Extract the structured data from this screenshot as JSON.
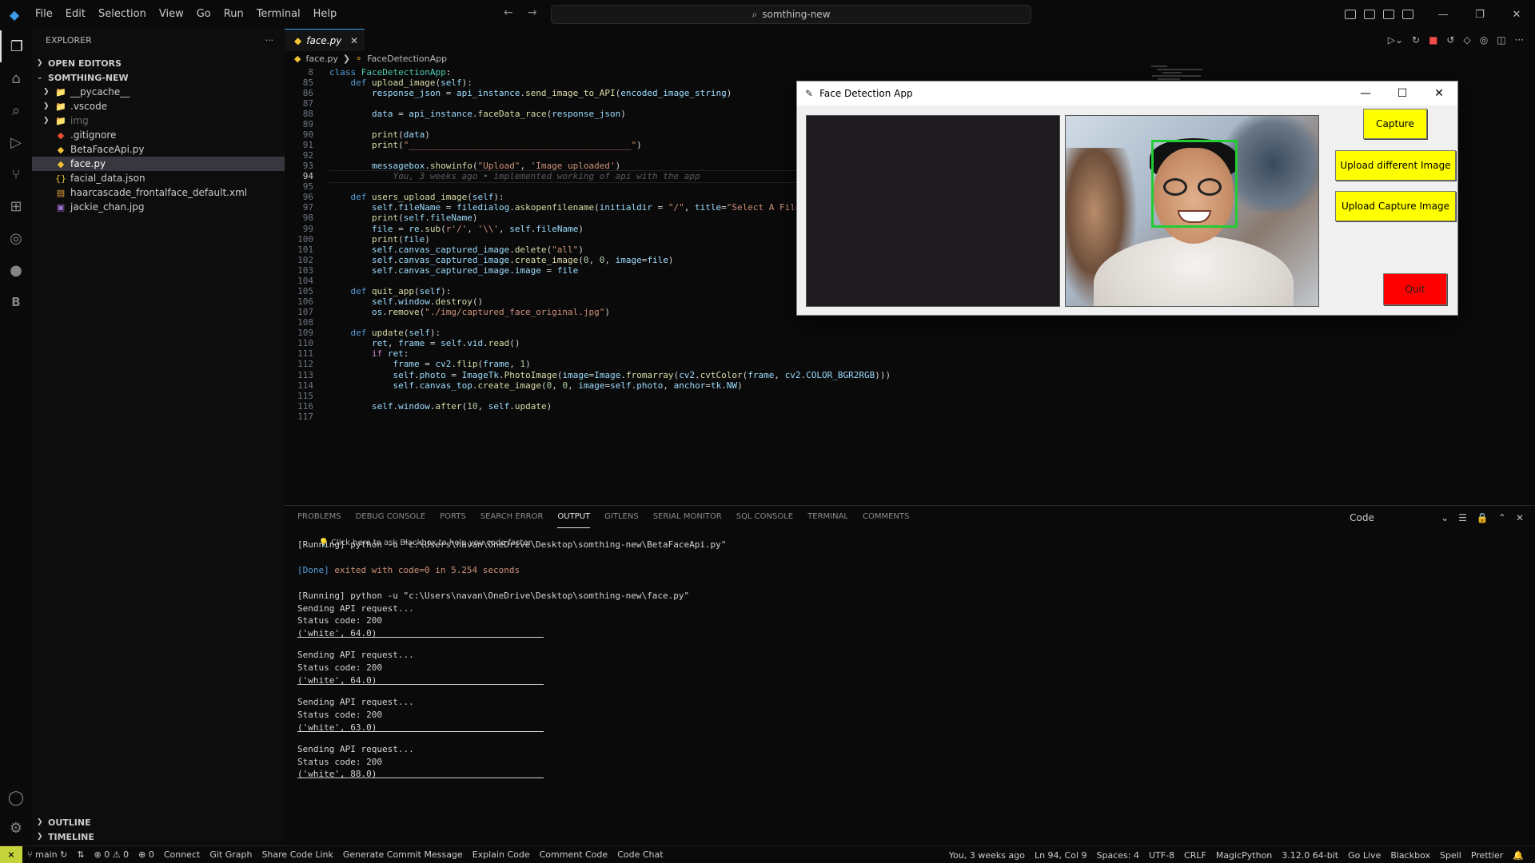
{
  "titlebar": {
    "menu": [
      "File",
      "Edit",
      "Selection",
      "View",
      "Go",
      "Run",
      "Terminal",
      "Help"
    ],
    "search_text": "somthing-new"
  },
  "sidebar": {
    "header": "EXPLORER",
    "open_editors": "OPEN EDITORS",
    "project": "SOMTHING-NEW",
    "items": [
      {
        "label": "__pycache__",
        "type": "folder",
        "color": "#cccccc"
      },
      {
        "label": ".vscode",
        "type": "folder",
        "color": "#cccccc"
      },
      {
        "label": "img",
        "type": "folder",
        "color": "#6e6e6e"
      },
      {
        "label": ".gitignore",
        "type": "git",
        "color": "#cccccc"
      },
      {
        "label": "BetaFaceApi.py",
        "type": "python",
        "color": "#cccccc"
      },
      {
        "label": "face.py",
        "type": "python",
        "color": "#ffffff"
      },
      {
        "label": "facial_data.json",
        "type": "json",
        "color": "#cccccc"
      },
      {
        "label": "haarcascade_frontalface_default.xml",
        "type": "xml",
        "color": "#cccccc"
      },
      {
        "label": "jackie_chan.jpg",
        "type": "image",
        "color": "#cccccc"
      }
    ],
    "outline": "OUTLINE",
    "timeline": "TIMELINE"
  },
  "editor": {
    "tab": "face.py",
    "breadcrumb_file": "face.py",
    "breadcrumb_class": "FaceDetectionApp",
    "lines": [
      {
        "n": "8",
        "html": "<span class='kw'>class</span> <span class='cls'>FaceDetectionApp</span>:"
      },
      {
        "n": "85",
        "html": "    <span class='kw'>def</span> <span class='fn'>upload_image</span>(<span class='var'>self</span>):"
      },
      {
        "n": "86",
        "html": "        <span class='var'>response_json</span> = <span class='var'>api_instance</span>.<span class='fn'>send_image_to_API</span>(<span class='var'>encoded_image_string</span>)"
      },
      {
        "n": "87",
        "html": ""
      },
      {
        "n": "88",
        "html": "        <span class='var'>data</span> = <span class='var'>api_instance</span>.<span class='fn'>faceData_race</span>(<span class='var'>response_json</span>)"
      },
      {
        "n": "89",
        "html": ""
      },
      {
        "n": "90",
        "html": "        <span class='fn'>print</span>(<span class='var'>data</span>)"
      },
      {
        "n": "91",
        "html": "        <span class='fn'>print</span>(<span class='str'>\"__________________________________________\"</span>)"
      },
      {
        "n": "92",
        "html": ""
      },
      {
        "n": "93",
        "html": "        <span class='var'>messagebox</span>.<span class='fn'>showinfo</span>(<span class='str'>\"Upload\"</span>, <span class='str'>'Image uploaded'</span>)"
      },
      {
        "n": "94",
        "html": "            <span class='blame'>You, 3 weeks ago • implemented working of api with the app</span>"
      },
      {
        "n": "95",
        "html": ""
      },
      {
        "n": "96",
        "html": "    <span class='kw'>def</span> <span class='fn'>users_upload_image</span>(<span class='var'>self</span>):"
      },
      {
        "n": "97",
        "html": "        <span class='var'>self</span>.<span class='var'>fileName</span> = <span class='var'>filedialog</span>.<span class='fn'>askopenfilename</span>(<span class='var'>initialdir</span> = <span class='str'>\"/\"</span>, <span class='var'>title</span>=<span class='str'>\"Select A File\"</span>,"
      },
      {
        "n": "98",
        "html": "        <span class='fn'>print</span>(<span class='var'>self</span>.<span class='var'>fileName</span>)"
      },
      {
        "n": "99",
        "html": "        <span class='var'>file</span> = <span class='var'>re</span>.<span class='fn'>sub</span>(<span class='str'>r'/'</span>, <span class='str'>'\\\\'</span>, <span class='var'>self</span>.<span class='var'>fileName</span>)"
      },
      {
        "n": "100",
        "html": "        <span class='fn'>print</span>(<span class='var'>file</span>)"
      },
      {
        "n": "101",
        "html": "        <span class='var'>self</span>.<span class='var'>canvas_captured_image</span>.<span class='fn'>delete</span>(<span class='str'>\"all\"</span>)"
      },
      {
        "n": "102",
        "html": "        <span class='var'>self</span>.<span class='var'>canvas_captured_image</span>.<span class='fn'>create_image</span>(<span class='num'>0</span>, <span class='num'>0</span>, <span class='var'>image</span>=<span class='var'>file</span>)"
      },
      {
        "n": "103",
        "html": "        <span class='var'>self</span>.<span class='var'>canvas_captured_image</span>.<span class='var'>image</span> = <span class='var'>file</span>"
      },
      {
        "n": "104",
        "html": ""
      },
      {
        "n": "105",
        "html": "    <span class='kw'>def</span> <span class='fn'>quit_app</span>(<span class='var'>self</span>):"
      },
      {
        "n": "106",
        "html": "        <span class='var'>self</span>.<span class='var'>window</span>.<span class='fn'>destroy</span>()"
      },
      {
        "n": "107",
        "html": "        <span class='var'>os</span>.<span class='fn'>remove</span>(<span class='str'>\"./img/captured_face_original.jpg\"</span>)"
      },
      {
        "n": "108",
        "html": ""
      },
      {
        "n": "109",
        "html": "    <span class='kw'>def</span> <span class='fn'>update</span>(<span class='var'>self</span>):"
      },
      {
        "n": "110",
        "html": "        <span class='var'>ret</span>, <span class='var'>frame</span> = <span class='var'>self</span>.<span class='var'>vid</span>.<span class='fn'>read</span>()"
      },
      {
        "n": "111",
        "html": "        <span class='kw2'>if</span> <span class='var'>ret</span>:"
      },
      {
        "n": "112",
        "html": "            <span class='var'>frame</span> = <span class='var'>cv2</span>.<span class='fn'>flip</span>(<span class='var'>frame</span>, <span class='num'>1</span>)"
      },
      {
        "n": "113",
        "html": "            <span class='var'>self</span>.<span class='var'>photo</span> = <span class='var'>ImageTk</span>.<span class='fn'>PhotoImage</span>(<span class='var'>image</span>=<span class='var'>Image</span>.<span class='fn'>fromarray</span>(<span class='var'>cv2</span>.<span class='fn'>cvtColor</span>(<span class='var'>frame</span>, <span class='var'>cv2</span>.<span class='var'>COLOR_BGR2RGB</span>)))"
      },
      {
        "n": "114",
        "html": "            <span class='var'>self</span>.<span class='var'>canvas_top</span>.<span class='fn'>create_image</span>(<span class='num'>0</span>, <span class='num'>0</span>, <span class='var'>image</span>=<span class='var'>self</span>.<span class='var'>photo</span>, <span class='var'>anchor</span>=<span class='var'>tk</span>.<span class='var'>NW</span>)"
      },
      {
        "n": "115",
        "html": ""
      },
      {
        "n": "116",
        "html": "        <span class='var'>self</span>.<span class='var'>window</span>.<span class='fn'>after</span>(<span class='num'>10</span>, <span class='var'>self</span>.<span class='fn'>update</span>)"
      },
      {
        "n": "117",
        "html": ""
      }
    ]
  },
  "panel": {
    "tabs": [
      "PROBLEMS",
      "DEBUG CONSOLE",
      "PORTS",
      "SEARCH ERROR",
      "OUTPUT",
      "GITLENS",
      "SERIAL MONITOR",
      "SQL CONSOLE",
      "TERMINAL",
      "COMMENTS"
    ],
    "active_tab": "OUTPUT",
    "channel": "Code",
    "hint": "💡 Click here to ask Blackbox to help you code faster",
    "output": [
      "[Running] python -u \"c:\\Users\\navan\\OneDrive\\Desktop\\somthing-new\\BetaFaceApi.py\"",
      "",
      "[Done] exited with code=0 in 5.254 seconds",
      "",
      "[Running] python -u \"c:\\Users\\navan\\OneDrive\\Desktop\\somthing-new\\face.py\"",
      "Sending API request...",
      "Status code: 200",
      "('white', 64.0)",
      "__SEP__",
      "Sending API request...",
      "Status code: 200",
      "('white', 64.0)",
      "__SEP__",
      "Sending API request...",
      "Status code: 200",
      "('white', 63.0)",
      "__SEP__",
      "Sending API request...",
      "Status code: 200",
      "('white', 88.0)",
      "__SEP__"
    ]
  },
  "statusbar": {
    "branch": "main",
    "errors": "0",
    "warnings": "0",
    "ports": "0",
    "left_items": [
      "Connect",
      "Git Graph",
      "Share Code Link",
      "Generate Commit Message",
      "Explain Code",
      "Comment Code",
      "Code Chat"
    ],
    "right_items": [
      "You, 3 weeks ago",
      "Ln 94, Col 9",
      "Spaces: 4",
      "UTF-8",
      "CRLF",
      "MagicPython",
      "3.12.0 64-bit",
      "Go Live",
      "Blackbox",
      "Spell",
      "Prettier"
    ]
  },
  "tk_app": {
    "title": "Face Detection App",
    "buttons": {
      "capture": "Capture",
      "upload_different": "Upload different Image",
      "upload_capture": "Upload Capture Image",
      "quit": "Quit"
    },
    "colors": {
      "button": "#ffff00",
      "quit": "#ff0000",
      "face_box": "#22cc33"
    }
  }
}
